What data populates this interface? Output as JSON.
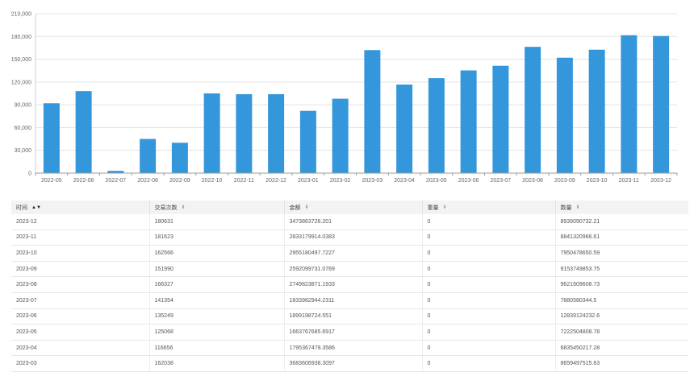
{
  "chart_data": {
    "type": "bar",
    "categories": [
      "2022-05",
      "2022-06",
      "2022-07",
      "2022-08",
      "2022-09",
      "2022-10",
      "2022-11",
      "2022-12",
      "2023-01",
      "2023-02",
      "2023-03",
      "2023-04",
      "2023-05",
      "2023-06",
      "2023-07",
      "2023-08",
      "2023-09",
      "2023-10",
      "2023-11",
      "2023-12"
    ],
    "values": [
      92000,
      108000,
      3000,
      45000,
      40000,
      105000,
      104000,
      104000,
      82000,
      98000,
      162038,
      116656,
      125068,
      135249,
      141354,
      166327,
      151990,
      162566,
      181623,
      180631
    ],
    "ylim": [
      0,
      210000
    ],
    "yticks": [
      "0",
      "30,000",
      "60,000",
      "90,000",
      "120,000",
      "150,000",
      "180,000",
      "210,000"
    ],
    "grid": true,
    "bar_color": "#3497db"
  },
  "table": {
    "columns": [
      {
        "label": "时间",
        "sort": "active"
      },
      {
        "label": "交易次数",
        "sort": "both"
      },
      {
        "label": "金额",
        "sort": "both"
      },
      {
        "label": "重量",
        "sort": "both"
      },
      {
        "label": "数量",
        "sort": "both"
      }
    ],
    "rows": [
      [
        "2023-12",
        "180631",
        "3473863726.201",
        "0",
        "8939090732.21"
      ],
      [
        "2023-11",
        "181623",
        "2833179914.0383",
        "0",
        "8841320966.61"
      ],
      [
        "2023-10",
        "162566",
        "2955180497.7227",
        "0",
        "7950478650.59"
      ],
      [
        "2023-09",
        "151990",
        "2592099731.0769",
        "0",
        "9153749853.75"
      ],
      [
        "2023-08",
        "166327",
        "2749823871.1933",
        "0",
        "9621609608.73"
      ],
      [
        "2023-07",
        "141354",
        "1833982944.2311",
        "0",
        "7880580344.5"
      ],
      [
        "2023-06",
        "135249",
        "1899198724.551",
        "0",
        "12839124232.6"
      ],
      [
        "2023-05",
        "125068",
        "1663767685.6917",
        "0",
        "7222504808.78"
      ],
      [
        "2023-04",
        "116656",
        "1795367479.3586",
        "0",
        "6835450217.28"
      ],
      [
        "2023-03",
        "162038",
        "3683606938.3097",
        "0",
        "8659497515.63"
      ]
    ]
  }
}
